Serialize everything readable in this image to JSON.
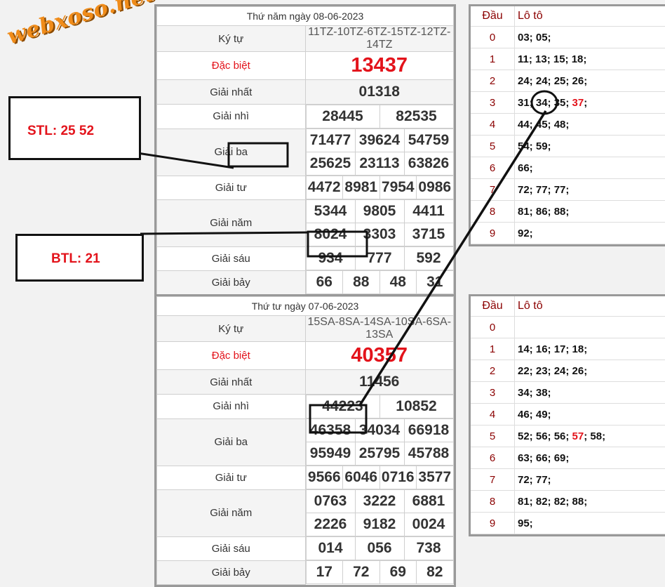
{
  "logo": "webxoso.net",
  "labels": {
    "ky_tu": "Ký tự",
    "dac_biet": "Đặc biệt",
    "giai_nhat": "Giải nhất",
    "giai_nhi": "Giải nhì",
    "giai_ba": "Giải ba",
    "giai_tu": "Giải tư",
    "giai_nam": "Giải năm",
    "giai_sau": "Giải sáu",
    "giai_bay": "Giải bảy",
    "dau": "Đầu",
    "loto": "Lô tô"
  },
  "results": [
    {
      "date": "Thứ năm ngày 08-06-2023",
      "ky_tu": "11TZ-10TZ-6TZ-15TZ-12TZ-14TZ",
      "dac_biet": "13437",
      "giai_nhat": "01318",
      "giai_nhi": [
        "28445",
        "82535"
      ],
      "giai_ba": [
        "71477",
        "39624",
        "54759",
        "25625",
        "23113",
        "63826"
      ],
      "giai_tu": [
        "4472",
        "8981",
        "7954",
        "0986"
      ],
      "giai_nam": [
        "5344",
        "9805",
        "4411",
        "8024",
        "3303",
        "3715"
      ],
      "giai_sau": [
        "934",
        "777",
        "592"
      ],
      "giai_bay": [
        "66",
        "88",
        "48",
        "31"
      ]
    },
    {
      "date": "Thứ tư ngày 07-06-2023",
      "ky_tu": "15SA-8SA-14SA-10SA-6SA-13SA",
      "dac_biet": "40357",
      "giai_nhat": "11456",
      "giai_nhi": [
        "44223",
        "10852"
      ],
      "giai_ba": [
        "46358",
        "34034",
        "66918",
        "95949",
        "25795",
        "45788"
      ],
      "giai_tu": [
        "9566",
        "6046",
        "0716",
        "3577"
      ],
      "giai_nam": [
        "0763",
        "3222",
        "6881",
        "2226",
        "9182",
        "0024"
      ],
      "giai_sau": [
        "014",
        "056",
        "738"
      ],
      "giai_bay": [
        "17",
        "72",
        "69",
        "82"
      ]
    }
  ],
  "loto_tables": [
    {
      "rows": [
        {
          "dau": "0",
          "pre": "03; 05;",
          "hl": "",
          "post": ""
        },
        {
          "dau": "1",
          "pre": "11; 13; 15; 18;",
          "hl": "",
          "post": ""
        },
        {
          "dau": "2",
          "pre": "24; 24; 25; 26;",
          "hl": "",
          "post": ""
        },
        {
          "dau": "3",
          "pre": "31; 34; 35; ",
          "hl": "37",
          "post": ";"
        },
        {
          "dau": "4",
          "pre": "44; 45; 48;",
          "hl": "",
          "post": ""
        },
        {
          "dau": "5",
          "pre": "54; 59;",
          "hl": "",
          "post": ""
        },
        {
          "dau": "6",
          "pre": "66;",
          "hl": "",
          "post": ""
        },
        {
          "dau": "7",
          "pre": "72; 77; 77;",
          "hl": "",
          "post": ""
        },
        {
          "dau": "8",
          "pre": "81; 86; 88;",
          "hl": "",
          "post": ""
        },
        {
          "dau": "9",
          "pre": "92;",
          "hl": "",
          "post": ""
        }
      ]
    },
    {
      "rows": [
        {
          "dau": "0",
          "pre": "",
          "hl": "",
          "post": ""
        },
        {
          "dau": "1",
          "pre": "14; 16; 17; 18;",
          "hl": "",
          "post": ""
        },
        {
          "dau": "2",
          "pre": "22; 23; 24; 26;",
          "hl": "",
          "post": ""
        },
        {
          "dau": "3",
          "pre": "34; 38;",
          "hl": "",
          "post": ""
        },
        {
          "dau": "4",
          "pre": "46; 49;",
          "hl": "",
          "post": ""
        },
        {
          "dau": "5",
          "pre": "52; 56; 56; ",
          "hl": "57",
          "post": "; 58;"
        },
        {
          "dau": "6",
          "pre": "63; 66; 69;",
          "hl": "",
          "post": ""
        },
        {
          "dau": "7",
          "pre": "72; 77;",
          "hl": "",
          "post": ""
        },
        {
          "dau": "8",
          "pre": "81; 82; 82; 88;",
          "hl": "",
          "post": ""
        },
        {
          "dau": "9",
          "pre": "95;",
          "hl": "",
          "post": ""
        }
      ]
    }
  ],
  "annotations": {
    "stl": "STL: 25 52",
    "btl": "BTL: 21"
  },
  "colors": {
    "accent_red": "#e3131b",
    "dau_red": "#8b0000",
    "logo_orange": "#f08c1a"
  }
}
